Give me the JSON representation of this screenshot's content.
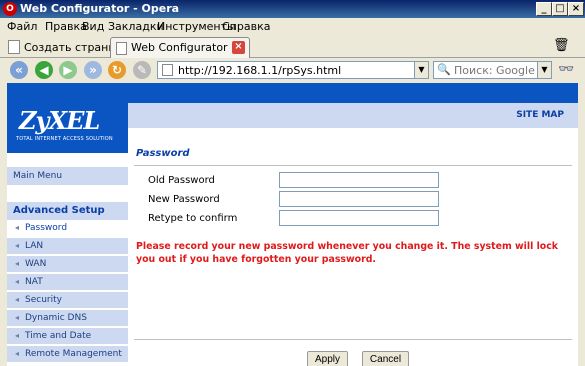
{
  "window": {
    "title": "Web Configurator - Opera",
    "app_icon": "opera-logo-icon"
  },
  "menu": [
    "Файл",
    "Правка",
    "Вид",
    "Закладки",
    "Инструменты",
    "Справка"
  ],
  "tabs": {
    "new_tab_label": "Создать страницу",
    "active_tab_label": "Web Configurator"
  },
  "toolbar": {
    "url": "http://192.168.1.1/rpSys.html",
    "search_placeholder": "Поиск: Google"
  },
  "router": {
    "brand": "ZyXEL",
    "tagline": "TOTAL INTERNET ACCESS SOLUTION",
    "site_map": "SITE MAP",
    "main_menu": "Main Menu",
    "advanced_setup": "Advanced Setup",
    "submenu": [
      "Password",
      "LAN",
      "WAN",
      "NAT",
      "Security",
      "Dynamic DNS",
      "Time and Date",
      "Remote Management"
    ],
    "active_submenu": "Password"
  },
  "form": {
    "heading": "Password",
    "old_password_label": "Old Password",
    "new_password_label": "New Password",
    "retype_label": "Retype to confirm",
    "old_password_value": "",
    "new_password_value": "",
    "retype_value": "",
    "warning": "Please record your new password whenever you change it. The system will lock you out if you have forgotten your password.",
    "apply_label": "Apply",
    "cancel_label": "Cancel"
  },
  "colors": {
    "brand_blue": "#0b55c3",
    "sidebar_bg": "#ccd9f0",
    "warning_red": "#e01a1a"
  }
}
